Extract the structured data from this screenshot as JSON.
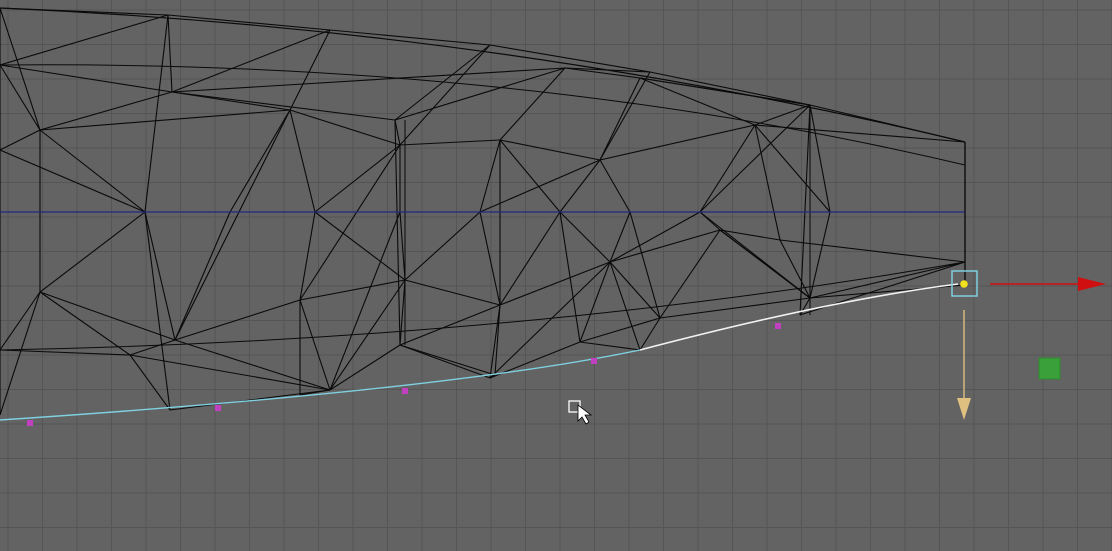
{
  "viewport": {
    "background": "#636363",
    "grid_color": "#555555",
    "wire_color": "#0a0a0a",
    "axis_color": "#1f2a80",
    "selected_edge_color": "#7fd0e0",
    "highlight_edge_color": "#f2f2f2",
    "vertex_color": "#c040c0",
    "manipulator": {
      "x_axis_color": "#d01010",
      "y_axis_color": "#e0c080",
      "pivot_color": "#f0e020",
      "handle_color": "#7fd0e0"
    },
    "scale_box_color": "#3aa03a"
  },
  "icons": {
    "cursor": "arrow-cursor-icon",
    "cursor_box": "select-box-icon",
    "x_arrow": "x-axis-arrow-icon",
    "y_arrow": "y-axis-arrow-icon",
    "pivot": "pivot-point-icon",
    "handle": "manipulator-handle-icon",
    "scale": "scale-handle-icon"
  }
}
